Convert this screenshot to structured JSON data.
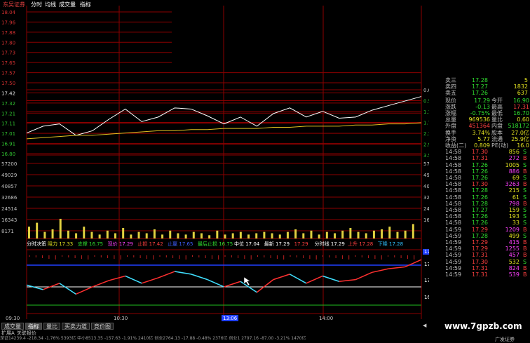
{
  "toolbar": {
    "broker": "东吴证券",
    "tabs": [
      "分时",
      "均线",
      "成交量",
      "指标"
    ]
  },
  "price_axis": {
    "left": [
      "18.04",
      "17.96",
      "17.88",
      "17.80",
      "17.73",
      "17.65",
      "17.57",
      "17.50",
      "17.42",
      "17.32",
      "17.21",
      "17.11",
      "17.01",
      "16.91",
      "16.80"
    ],
    "right_pct": [
      "0.00%",
      "0.59%",
      "1.18%",
      "1.77%",
      "2.36%",
      "2.95%",
      "3.54%"
    ]
  },
  "volume_axis": {
    "left": [
      "57200",
      "49029",
      "40857",
      "32686",
      "24514",
      "16343",
      "8171"
    ],
    "right": [
      "57200",
      "49029",
      "40857",
      "32686",
      "24514",
      "16343"
    ]
  },
  "indicator_header": {
    "name": "分时决策",
    "items": [
      {
        "label": "阻力",
        "value": "17.33"
      },
      {
        "label": "支撑",
        "value": "16.75"
      },
      {
        "label": "现价",
        "value": "17.29"
      },
      {
        "label": "止损",
        "value": "17.42"
      },
      {
        "label": "止赢",
        "value": "17.65"
      },
      {
        "label": "最后止损",
        "value": "16.75"
      },
      {
        "label": "中位",
        "value": "17.04"
      },
      {
        "label": "最新",
        "value": "17.29"
      },
      {
        "label": "",
        "value": "17.29"
      },
      {
        "label": "分时线",
        "value": "17.29"
      },
      {
        "label": "上升",
        "value": "17.28"
      },
      {
        "label": "下降",
        "value": "17.28"
      }
    ]
  },
  "indicator_axis": [
    "17.49",
    "17.36",
    "17.10",
    "16.84"
  ],
  "time_axis": [
    "09:30",
    "10:30",
    "13:06",
    "14:00"
  ],
  "bottom_tabs": [
    "成交量",
    "指标",
    "量比",
    "买卖力道",
    "竞价图"
  ],
  "bottom_tabs2": [
    "扩展A",
    "关联报价"
  ],
  "quote": {
    "asks": [
      {
        "label": "卖三",
        "price": "17.28",
        "vol": "5"
      },
      {
        "label": "卖四",
        "price": "17.27",
        "vol": "1832"
      },
      {
        "label": "卖五",
        "price": "17.26",
        "vol": "637"
      }
    ],
    "stats": [
      {
        "l1": "现价",
        "v1": "17.29",
        "l2": "今开",
        "v2": "16.90"
      },
      {
        "l1": "涨跌",
        "v1": "-0.13",
        "l2": "最高",
        "v2": "17.31"
      },
      {
        "l1": "涨幅",
        "v1": "-0.75%",
        "l2": "最低",
        "v2": "16.70"
      },
      {
        "l1": "总量",
        "v1": "969536",
        "l2": "量比",
        "v2": "0.60"
      },
      {
        "l1": "外盘",
        "v1": "451364",
        "l2": "内盘",
        "v2": "518172"
      },
      {
        "l1": "换手",
        "v1": "3.74%",
        "l2": "股本",
        "v2": "27.0亿"
      },
      {
        "l1": "净资",
        "v1": "5.77",
        "l2": "流通",
        "v2": "25.9亿"
      },
      {
        "l1": "收益(二)",
        "v1": "0.809",
        "l2": "PE(动)",
        "v2": "16.0"
      }
    ],
    "ticks": [
      {
        "t": "14:58",
        "p": "17.30",
        "v": "856",
        "s": "S"
      },
      {
        "t": "14:58",
        "p": "17.31",
        "v": "272",
        "s": "B"
      },
      {
        "t": "14:58",
        "p": "17.26",
        "v": "1005",
        "s": "S"
      },
      {
        "t": "14:58",
        "p": "17.26",
        "v": "886",
        "s": "B"
      },
      {
        "t": "14:58",
        "p": "17.26",
        "v": "69",
        "s": "S"
      },
      {
        "t": "14:58",
        "p": "17.30",
        "v": "3263",
        "s": "B"
      },
      {
        "t": "14:58",
        "p": "17.28",
        "v": "215",
        "s": "S"
      },
      {
        "t": "14:58",
        "p": "17.26",
        "v": "61",
        "s": "S"
      },
      {
        "t": "14:58",
        "p": "17.28",
        "v": "798",
        "s": "B"
      },
      {
        "t": "14:58",
        "p": "17.27",
        "v": "159",
        "s": "S"
      },
      {
        "t": "14:58",
        "p": "17.26",
        "v": "193",
        "s": "S"
      },
      {
        "t": "14:58",
        "p": "17.26",
        "v": "33",
        "s": "S"
      },
      {
        "t": "14:59",
        "p": "17.29",
        "v": "1209",
        "s": "B"
      },
      {
        "t": "14:59",
        "p": "17.28",
        "v": "499",
        "s": "S"
      },
      {
        "t": "14:59",
        "p": "17.29",
        "v": "415",
        "s": "B"
      },
      {
        "t": "14:59",
        "p": "17.29",
        "v": "1255",
        "s": "B"
      },
      {
        "t": "14:59",
        "p": "17.31",
        "v": "457",
        "s": "B"
      },
      {
        "t": "14:59",
        "p": "17.30",
        "v": "532",
        "s": "S"
      },
      {
        "t": "14:59",
        "p": "17.31",
        "v": "824",
        "s": "B"
      },
      {
        "t": "14:59",
        "p": "17.31",
        "v": "539",
        "s": "B"
      }
    ]
  },
  "status_bar": "深证14239.4 -218.34 -1.76% 5393亿 中小8513.35 -157.63 -1.91% 2410亿 创业2764.13 -17.88 -0.48% 2376亿 创业1 2797.16 -87.00 -3.21% 1470亿",
  "broker_status": "广发证券",
  "watermark": "www.7gpzb.com",
  "chart_data": [
    {
      "type": "line",
      "x": [
        "09:30",
        "10:30",
        "13:06",
        "14:00"
      ],
      "ylim": [
        16.8,
        18.04
      ],
      "series": [
        {
          "values": [
            16.98,
            17.04,
            17.06,
            16.96,
            17.0,
            17.1,
            17.19,
            17.08,
            17.12,
            17.2,
            17.19,
            17.13,
            17.06,
            17.12,
            17.04,
            17.15,
            17.2,
            17.12,
            17.17,
            17.11,
            17.12,
            17.18,
            17.22,
            17.26,
            17.3
          ]
        },
        {
          "values": [
            16.93,
            16.94,
            16.95,
            16.96,
            16.96,
            16.97,
            16.98,
            16.99,
            17.0,
            17.0,
            17.01,
            17.01,
            17.02,
            17.02,
            17.02,
            17.03,
            17.03,
            17.04,
            17.04,
            17.04,
            17.05,
            17.05,
            17.06,
            17.06,
            17.07
          ]
        }
      ]
    },
    {
      "type": "bar",
      "ylim": [
        0,
        57200
      ],
      "values": [
        9000,
        12000,
        5000,
        7000,
        15000,
        6000,
        4000,
        9000,
        5000,
        3000,
        6000,
        4000,
        8000,
        3000,
        5000,
        4000,
        7000,
        3000,
        6000,
        4000,
        3000,
        5000,
        4000,
        2500,
        6000,
        3000,
        4000,
        5000,
        3000,
        4000,
        5000,
        4000,
        3000,
        5000,
        7000,
        4000,
        6000,
        3000,
        5000,
        4000,
        6000,
        8000,
        5000,
        4000,
        6000,
        7000,
        9000,
        5000,
        6000,
        11000
      ]
    },
    {
      "type": "line",
      "ylim": [
        16.84,
        17.49
      ],
      "series": [
        {
          "values": [
            17.1,
            17.05,
            17.12,
            17.0,
            17.08,
            17.15,
            17.2,
            17.12,
            17.18,
            17.25,
            17.22,
            17.16,
            17.08,
            17.14,
            17.02,
            17.16,
            17.22,
            17.12,
            17.2,
            17.14,
            17.16,
            17.24,
            17.28,
            17.3,
            17.38
          ]
        }
      ]
    }
  ]
}
